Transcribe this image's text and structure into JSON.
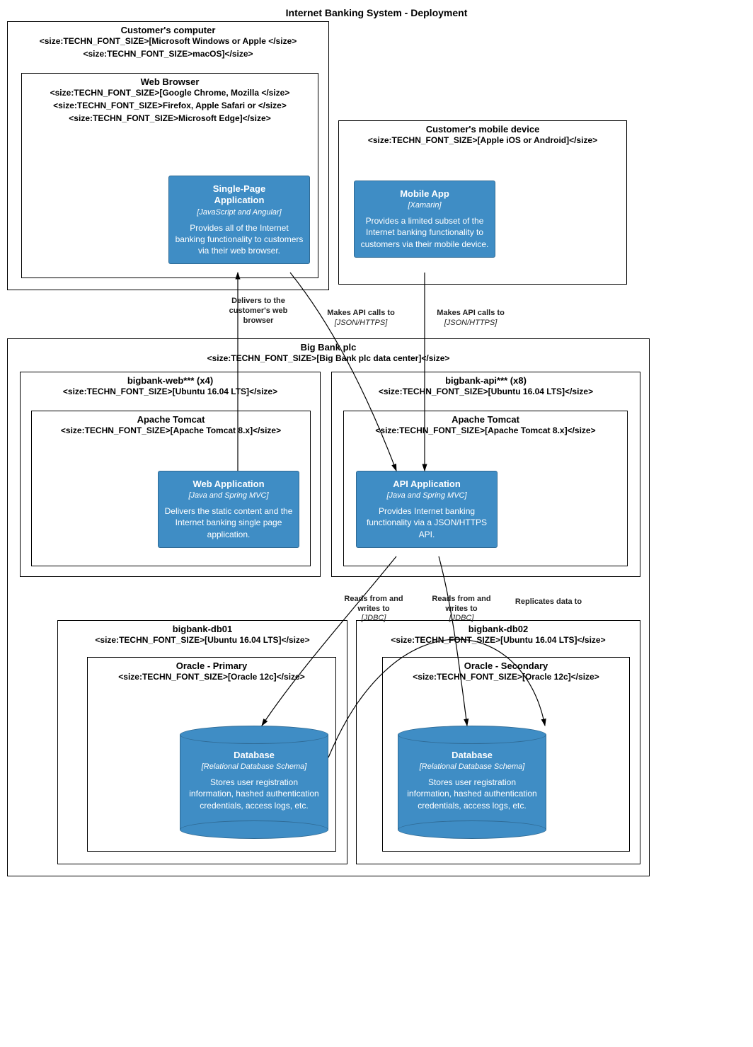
{
  "title": "Internet Banking System - Deployment",
  "nodes": {
    "customer_computer": {
      "title": "Customer's computer",
      "sub": [
        "<size:TECHN_FONT_SIZE>[Microsoft Windows or Apple </size>",
        "<size:TECHN_FONT_SIZE>macOS]</size>"
      ]
    },
    "web_browser": {
      "title": "Web Browser",
      "sub": [
        "<size:TECHN_FONT_SIZE>[Google Chrome, Mozilla </size>",
        "<size:TECHN_FONT_SIZE>Firefox, Apple Safari or </size>",
        "<size:TECHN_FONT_SIZE>Microsoft Edge]</size>"
      ]
    },
    "mobile_device": {
      "title": "Customer's mobile device",
      "sub": [
        "<size:TECHN_FONT_SIZE>[Apple iOS or Android]</size>"
      ]
    },
    "big_bank": {
      "title": "Big Bank plc",
      "sub": [
        "<size:TECHN_FONT_SIZE>[Big Bank plc data center]</size>"
      ]
    },
    "bigbank_web": {
      "title": "bigbank-web*** (x4)",
      "sub": [
        "<size:TECHN_FONT_SIZE>[Ubuntu 16.04 LTS]</size>"
      ]
    },
    "tomcat_web": {
      "title": "Apache Tomcat",
      "sub": [
        "<size:TECHN_FONT_SIZE>[Apache Tomcat 8.x]</size>"
      ]
    },
    "bigbank_api": {
      "title": "bigbank-api*** (x8)",
      "sub": [
        "<size:TECHN_FONT_SIZE>[Ubuntu 16.04 LTS]</size>"
      ]
    },
    "tomcat_api": {
      "title": "Apache Tomcat",
      "sub": [
        "<size:TECHN_FONT_SIZE>[Apache Tomcat 8.x]</size>"
      ]
    },
    "bigbank_db01": {
      "title": "bigbank-db01",
      "sub": [
        "<size:TECHN_FONT_SIZE>[Ubuntu 16.04 LTS]</size>"
      ]
    },
    "oracle_primary": {
      "title": "Oracle - Primary",
      "sub": [
        "<size:TECHN_FONT_SIZE>[Oracle 12c]</size>"
      ]
    },
    "bigbank_db02": {
      "title": "bigbank-db02",
      "sub": [
        "<size:TECHN_FONT_SIZE>[Ubuntu 16.04 LTS]</size>"
      ]
    },
    "oracle_secondary": {
      "title": "Oracle - Secondary",
      "sub": [
        "<size:TECHN_FONT_SIZE>[Oracle 12c]</size>"
      ]
    }
  },
  "containers": {
    "spa": {
      "title": "Single-Page\nApplication",
      "tech": "[JavaScript and Angular]",
      "desc": "Provides all of the Internet banking functionality to customers via their web browser."
    },
    "mobile_app": {
      "title": "Mobile App",
      "tech": "[Xamarin]",
      "desc": "Provides a limited subset of the Internet banking functionality to customers via their mobile device."
    },
    "web_app": {
      "title": "Web Application",
      "tech": "[Java and Spring MVC]",
      "desc": "Delivers the static content and the Internet banking single page application."
    },
    "api_app": {
      "title": "API Application",
      "tech": "[Java and Spring MVC]",
      "desc": "Provides Internet banking functionality via a JSON/HTTPS API."
    },
    "db1": {
      "title": "Database",
      "tech": "[Relational Database Schema]",
      "desc": "Stores user registration information, hashed authentication credentials, access logs, etc."
    },
    "db2": {
      "title": "Database",
      "tech": "[Relational Database Schema]",
      "desc": "Stores user registration information, hashed authentication credentials, access logs, etc."
    }
  },
  "relationships": {
    "delivers": {
      "label": "Delivers to the\ncustomer's web\nbrowser"
    },
    "spa_api": {
      "label": "Makes API calls to",
      "tech": "[JSON/HTTPS]"
    },
    "mobile_api": {
      "label": "Makes API calls to",
      "tech": "[JSON/HTTPS]"
    },
    "api_db1": {
      "label": "Reads from and\nwrites to",
      "tech": "[JDBC]"
    },
    "api_db2": {
      "label": "Reads from and\nwrites to",
      "tech": "[JDBC]"
    },
    "replicate": {
      "label": "Replicates data to"
    }
  }
}
